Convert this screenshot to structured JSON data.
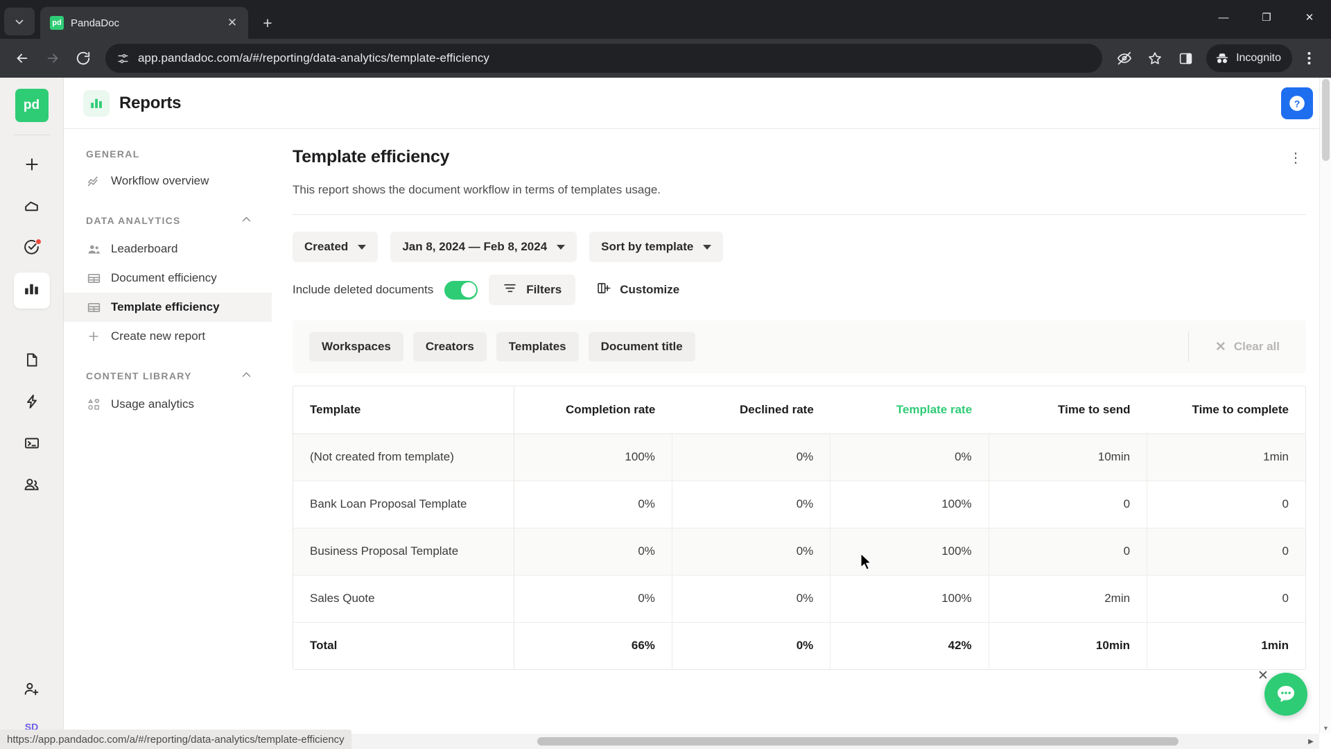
{
  "browser": {
    "tab": {
      "title": "PandaDoc",
      "favicon_text": "pd",
      "close_icon": "✕"
    },
    "new_tab_label": "+",
    "window_controls": {
      "minimize": "—",
      "maximize": "❐",
      "close": "✕"
    },
    "url": "app.pandadoc.com/a/#/reporting/data-analytics/template-efficiency",
    "profile_label": "Incognito",
    "status_url": "https://app.pandadoc.com/a/#/reporting/data-analytics/template-efficiency"
  },
  "rail": {
    "logo_text": "pd",
    "items": [
      {
        "name": "create-new",
        "icon": "plus"
      },
      {
        "name": "home",
        "icon": "home"
      },
      {
        "name": "tasks",
        "icon": "check-circle",
        "badge": true
      },
      {
        "name": "reports",
        "icon": "bar-chart",
        "active": true
      },
      {
        "name": "documents",
        "icon": "document"
      },
      {
        "name": "automations",
        "icon": "lightning"
      },
      {
        "name": "forms",
        "icon": "terminal"
      },
      {
        "name": "contacts",
        "icon": "people"
      }
    ],
    "avatar_initials": "SD"
  },
  "header": {
    "title": "Reports",
    "help_icon": "?"
  },
  "nav": {
    "sections": [
      {
        "title": "GENERAL",
        "collapsible": false,
        "items": [
          {
            "label": "Workflow overview",
            "icon": "trend-icon",
            "active": false
          }
        ]
      },
      {
        "title": "DATA ANALYTICS",
        "collapsible": true,
        "items": [
          {
            "label": "Leaderboard",
            "icon": "people-icon",
            "active": false
          },
          {
            "label": "Document efficiency",
            "icon": "table-icon",
            "active": false
          },
          {
            "label": "Template efficiency",
            "icon": "table-icon",
            "active": true
          },
          {
            "label": "Create new report",
            "icon": "plus-icon",
            "active": false
          }
        ]
      },
      {
        "title": "CONTENT LIBRARY",
        "collapsible": true,
        "items": [
          {
            "label": "Usage analytics",
            "icon": "shapes-icon",
            "active": false
          }
        ]
      }
    ]
  },
  "report": {
    "title": "Template efficiency",
    "description": "This report shows the document workflow in terms of templates usage.",
    "kebab_icon": "⋮",
    "filters": [
      {
        "label": "Created"
      },
      {
        "label": "Jan 8, 2024 — Feb 8, 2024"
      },
      {
        "label": "Sort by template"
      }
    ],
    "toggle": {
      "label": "Include deleted documents",
      "on": true
    },
    "buttons": [
      {
        "label": "Filters",
        "icon": "filter-icon"
      },
      {
        "label": "Customize",
        "icon": "customize-icon"
      }
    ],
    "chips": [
      "Workspaces",
      "Creators",
      "Templates",
      "Document title"
    ],
    "clear_all": {
      "label": "Clear all",
      "icon": "✕"
    }
  },
  "chart_data": {
    "type": "table",
    "title": "Template efficiency",
    "columns": [
      "Template",
      "Completion rate",
      "Declined rate",
      "Template rate",
      "Time to send",
      "Time to complete"
    ],
    "highlighted_column": "Template rate",
    "rows": [
      {
        "cells": [
          "(Not created from template)",
          "100%",
          "0%",
          "0%",
          "10min",
          "1min"
        ]
      },
      {
        "cells": [
          "Bank Loan Proposal Template",
          "0%",
          "0%",
          "100%",
          "0",
          "0"
        ]
      },
      {
        "cells": [
          "Business Proposal Template",
          "0%",
          "0%",
          "100%",
          "0",
          "0"
        ]
      },
      {
        "cells": [
          "Sales Quote",
          "0%",
          "0%",
          "100%",
          "2min",
          "0"
        ]
      }
    ],
    "total_row": {
      "cells": [
        "Total",
        "66%",
        "0%",
        "42%",
        "10min",
        "1min"
      ]
    }
  },
  "chat": {
    "close_icon": "✕",
    "bubble_icon": "•••"
  },
  "colors": {
    "brand_green": "#2fcc76",
    "help_blue": "#1e6ef0",
    "badge_red": "#f0483e"
  }
}
